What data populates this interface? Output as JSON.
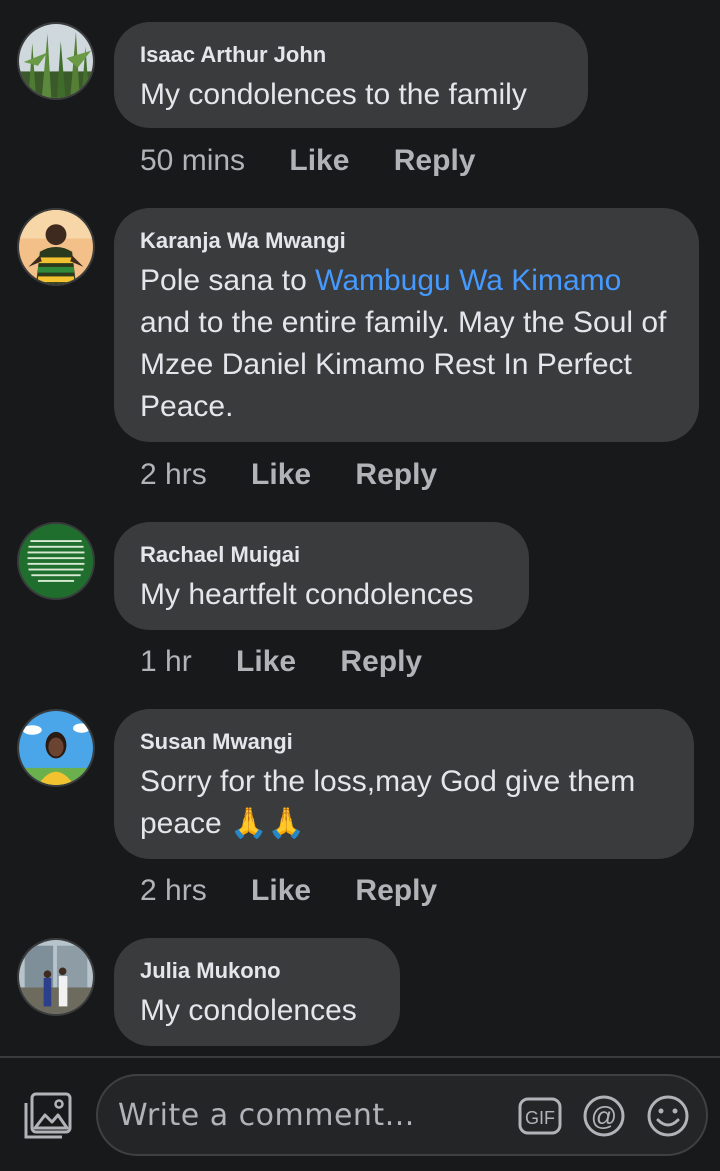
{
  "comments": [
    {
      "author": "Isaac Arthur John",
      "text": "My condolences to the family",
      "time": "50 mins",
      "like": "Like",
      "reply": "Reply"
    },
    {
      "author": "Karanja Wa Mwangi",
      "text_before": "Pole sana to ",
      "mention": "Wambugu Wa Kimamo",
      "text_after": " and to the entire family. May the Soul of Mzee Daniel Kimamo Rest In Perfect Peace.",
      "time": "2 hrs",
      "like": "Like",
      "reply": "Reply"
    },
    {
      "author": "Rachael Muigai",
      "text": "My heartfelt condolences",
      "time": "1 hr",
      "like": "Like",
      "reply": "Reply",
      "avatar_text": "When God turned situation around, Joseph became Prime Minister, Sarah became fruitful, Jabez became a rich man, Esther a slave became Queen. If your hands are not busy, type \" Lord turn my situation around\""
    },
    {
      "author": "Susan Mwangi",
      "text": "Sorry for the loss,may God give them peace",
      "emoji": "🙏🙏",
      "time": "2 hrs",
      "like": "Like",
      "reply": "Reply"
    },
    {
      "author": "Julia Mukono",
      "text": "My condolences"
    }
  ],
  "composer": {
    "placeholder": "Write a comment...",
    "gif_label": "GIF",
    "at_label": "@"
  },
  "icons": {
    "photo": "photo-icon",
    "gif": "gif-icon",
    "mention": "at-icon",
    "emoji": "smile-icon",
    "pray": "folded-hands-emoji"
  },
  "colors": {
    "background": "#18191a",
    "bubble": "#3a3b3c",
    "text": "#e4e6eb",
    "secondary": "#b0b3b8",
    "link": "#4599ff"
  }
}
